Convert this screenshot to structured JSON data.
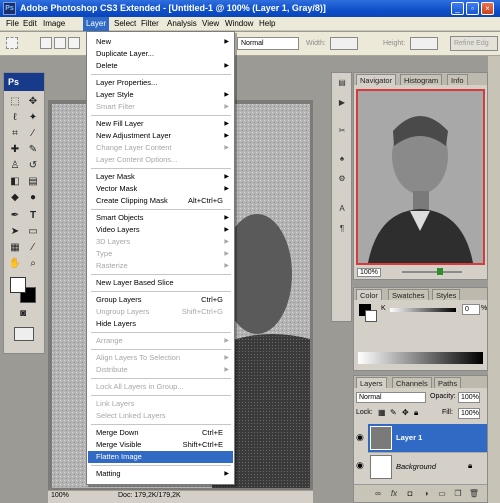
{
  "window": {
    "title": "Adobe Photoshop CS3 Extended - [Untitled-1 @ 100% (Layer 1, Gray/8)]",
    "app_icon": "Ps",
    "minimize": "_",
    "restore": "▫",
    "close": "×"
  },
  "menubar": [
    "File",
    "Edit",
    "Image",
    "Layer",
    "Select",
    "Filter",
    "Analysis",
    "View",
    "Window",
    "Help"
  ],
  "options": {
    "mode_value": "Normal",
    "width_label": "Width:",
    "height_label": "Height:",
    "refine_edge": "Refine Edg"
  },
  "tools": {
    "title": "Ps"
  },
  "layer_menu": [
    {
      "label": "New",
      "submenu": true
    },
    {
      "label": "Duplicate Layer..."
    },
    {
      "label": "Delete",
      "submenu": true
    },
    {
      "sep": true
    },
    {
      "label": "Layer Properties..."
    },
    {
      "label": "Layer Style",
      "submenu": true
    },
    {
      "label": "Smart Filter",
      "submenu": true,
      "disabled": true
    },
    {
      "sep": true
    },
    {
      "label": "New Fill Layer",
      "submenu": true
    },
    {
      "label": "New Adjustment Layer",
      "submenu": true
    },
    {
      "label": "Change Layer Content",
      "submenu": true,
      "disabled": true
    },
    {
      "label": "Layer Content Options...",
      "disabled": true
    },
    {
      "sep": true
    },
    {
      "label": "Layer Mask",
      "submenu": true
    },
    {
      "label": "Vector Mask",
      "submenu": true
    },
    {
      "label": "Create Clipping Mask",
      "shortcut": "Alt+Ctrl+G"
    },
    {
      "sep": true
    },
    {
      "label": "Smart Objects",
      "submenu": true
    },
    {
      "label": "Video Layers",
      "submenu": true
    },
    {
      "label": "3D Layers",
      "submenu": true,
      "disabled": true
    },
    {
      "label": "Type",
      "submenu": true,
      "disabled": true
    },
    {
      "label": "Rasterize",
      "submenu": true,
      "disabled": true
    },
    {
      "sep": true
    },
    {
      "label": "New Layer Based Slice"
    },
    {
      "sep": true
    },
    {
      "label": "Group Layers",
      "shortcut": "Ctrl+G"
    },
    {
      "label": "Ungroup Layers",
      "shortcut": "Shift+Ctrl+G",
      "disabled": true
    },
    {
      "label": "Hide Layers"
    },
    {
      "sep": true
    },
    {
      "label": "Arrange",
      "submenu": true,
      "disabled": true
    },
    {
      "sep": true
    },
    {
      "label": "Align Layers To Selection",
      "submenu": true,
      "disabled": true
    },
    {
      "label": "Distribute",
      "submenu": true,
      "disabled": true
    },
    {
      "sep": true
    },
    {
      "label": "Lock All Layers in Group...",
      "disabled": true
    },
    {
      "sep": true
    },
    {
      "label": "Link Layers",
      "disabled": true
    },
    {
      "label": "Select Linked Layers",
      "disabled": true
    },
    {
      "sep": true
    },
    {
      "label": "Merge Down",
      "shortcut": "Ctrl+E"
    },
    {
      "label": "Merge Visible",
      "shortcut": "Shift+Ctrl+E"
    },
    {
      "label": "Flatten Image",
      "highlighted": true
    },
    {
      "sep": true
    },
    {
      "label": "Matting",
      "submenu": true
    }
  ],
  "status": {
    "zoom": "100%",
    "doc": "Doc: 179,2K/179,2K"
  },
  "navigator": {
    "tabs": [
      "Navigator",
      "Histogram",
      "Info"
    ],
    "zoom": "100%"
  },
  "color_panel": {
    "tabs": [
      "Color",
      "Swatches",
      "Styles"
    ],
    "channel": "K",
    "value": "0",
    "unit": "%"
  },
  "layers_panel": {
    "tabs": [
      "Layers",
      "Channels",
      "Paths"
    ],
    "blend_mode": "Normal",
    "opacity_label": "Opacity:",
    "opacity": "100%",
    "lock_label": "Lock:",
    "fill_label": "Fill:",
    "fill": "100%",
    "layers": [
      {
        "name": "Layer 1",
        "selected": true
      },
      {
        "name": "Background",
        "locked": true
      }
    ],
    "footer_icons": [
      "link-icon",
      "fx-icon",
      "mask-icon",
      "adjustment-icon",
      "group-icon",
      "new-layer-icon",
      "trash-icon"
    ]
  }
}
